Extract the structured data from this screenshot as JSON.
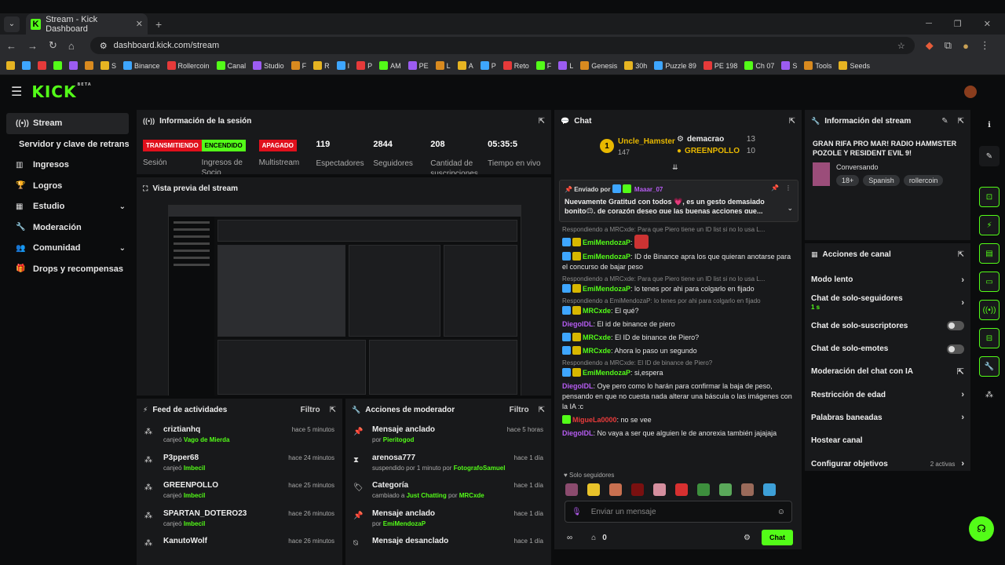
{
  "browser": {
    "tab_title": "Stream - Kick Dashboard",
    "url": "dashboard.kick.com/stream",
    "bookmarks": [
      "S",
      "Binance",
      "Rollercoin",
      "Canal",
      "Studio",
      "F",
      "R",
      "I",
      "P",
      "AM",
      "PE",
      "L",
      "A",
      "P",
      "Reto",
      "F",
      "L",
      "Genesis",
      "30h",
      "Puzzle 89",
      "PE 198",
      "Ch 07",
      "S",
      "Tools",
      "Seeds"
    ]
  },
  "site": {
    "logo": "KICK",
    "beta": "BETA"
  },
  "sidebar": {
    "items": [
      {
        "label": "Stream",
        "icon": "broadcast-icon",
        "active": true
      },
      {
        "label": "Servidor y clave de retransmisión",
        "sub": true
      },
      {
        "label": "Ingresos",
        "icon": "chart-icon"
      },
      {
        "label": "Logros",
        "icon": "trophy-icon"
      },
      {
        "label": "Estudio",
        "icon": "studio-icon",
        "chev": true
      },
      {
        "label": "Moderación",
        "icon": "wrench-icon"
      },
      {
        "label": "Comunidad",
        "icon": "people-icon",
        "chev": true
      },
      {
        "label": "Drops y recompensas",
        "icon": "gift-icon"
      }
    ]
  },
  "session": {
    "title": "Información de la sesión",
    "stats": [
      {
        "badge": "TRANSMITIENDO",
        "color": "red",
        "label": "Sesión"
      },
      {
        "badge": "ENCENDIDO",
        "color": "green",
        "label": "Ingresos de Socio"
      },
      {
        "badge": "APAGADO",
        "color": "red",
        "label": "Multistream"
      },
      {
        "value": "119",
        "label": "Espectadores"
      },
      {
        "value": "2844",
        "label": "Seguidores"
      },
      {
        "value": "208",
        "label": "Cantidad de suscripciones"
      },
      {
        "value": "05:35:5",
        "label": "Tiempo en vivo"
      }
    ]
  },
  "preview": {
    "title": "Vista previa del stream"
  },
  "feed": {
    "title": "Feed de actividades",
    "filter": "Filtro",
    "items": [
      {
        "name": "criztianhq",
        "action": "canjeó",
        "reward": "Vago de Mierda",
        "time": "hace 5 minutos"
      },
      {
        "name": "P3pper68",
        "action": "canjeó",
        "reward": "Imbecil",
        "time": "hace 24 minutos"
      },
      {
        "name": "GREENPOLLO",
        "action": "canjeó",
        "reward": "Imbecil",
        "time": "hace 25 minutos"
      },
      {
        "name": "SPARTAN_DOTERO23",
        "action": "canjeó",
        "reward": "Imbecil",
        "time": "hace 26 minutos"
      },
      {
        "name": "KanutoWolf",
        "action": "",
        "reward": "",
        "time": "hace 26 minutos"
      }
    ]
  },
  "modactions": {
    "title": "Acciones de moderador",
    "filter": "Filtro",
    "items": [
      {
        "name": "Mensaje anclado",
        "sub": "por",
        "who": "Pieritogod",
        "time": "hace 5 horas",
        "icon": "pin-icon"
      },
      {
        "name": "arenosa777",
        "sub": "suspendido por 1 minuto por",
        "who": "FotografoSamuel",
        "time": "hace 1 día",
        "icon": "hourglass-icon"
      },
      {
        "name": "Categoría",
        "sub": "cambiado a",
        "who": "Just Chatting",
        "sub2": "por",
        "who2": "MRCxde",
        "time": "hace 1 día",
        "icon": "tag-icon"
      },
      {
        "name": "Mensaje anclado",
        "sub": "por",
        "who": "EmiMendozaP",
        "time": "hace 1 día",
        "icon": "pin-icon"
      },
      {
        "name": "Mensaje desanclado",
        "sub": "",
        "who": "",
        "time": "hace 1 día",
        "icon": "unpin-icon"
      }
    ]
  },
  "chat": {
    "title": "Chat",
    "top1_name": "Uncle_Hamster",
    "top1_count": "147",
    "top1_rank": "1",
    "top2": [
      {
        "name": "demacrao",
        "count": "13"
      },
      {
        "name": "GREENPOLLO",
        "count": "10"
      }
    ],
    "pinned_by_label": "Enviado por",
    "pinned_by": "Maaar_07",
    "pinned_text": "Nuevamente Gratitud con todos 💗, es un gesto demasiado bonito😉, de corazón deseo que las buenas acciones que...",
    "messages": [
      {
        "reply": "Respondiendo a MRCxde: Para que Piero tiene un ID list si no lo usa L...",
        "user": "EmiMendozaP",
        "ucls": "ugreen",
        "text": "",
        "badges": [
          "blue",
          "gold"
        ]
      },
      {
        "reply": "",
        "user": "EmiMendozaP",
        "ucls": "ugreen",
        "text": "ID de Binance apra los que quieran anotarse para el concurso de bajar peso",
        "badges": [
          "blue",
          "gold"
        ]
      },
      {
        "reply": "Respondiendo a MRCxde: Para que Piero tiene un ID list si no lo usa L...",
        "user": "EmiMendozaP",
        "ucls": "ugreen",
        "text": "lo tenes por ahi para colgarlo en fijado",
        "badges": [
          "blue",
          "gold"
        ]
      },
      {
        "reply": "Respondiendo a EmiMendozaP: lo tenes por ahi para colgarlo en fijado",
        "user": "MRCxde",
        "ucls": "ugreen",
        "text": "El qué?",
        "badges": [
          "blue",
          "gold"
        ]
      },
      {
        "reply": "",
        "user": "DiegoIDL",
        "ucls": "upurple",
        "text": "El id de binance de piero",
        "badges": []
      },
      {
        "reply": "",
        "user": "MRCxde",
        "ucls": "ugreen",
        "text": "El ID de binance de Piero?",
        "badges": [
          "blue",
          "gold"
        ]
      },
      {
        "reply": "",
        "user": "MRCxde",
        "ucls": "ugreen",
        "text": "Ahora lo paso un segundo",
        "badges": [
          "blue",
          "gold"
        ]
      },
      {
        "reply": "Respondiendo a MRCxde: El ID de binance de Piero?",
        "user": "EmiMendozaP",
        "ucls": "ugreen",
        "text": "si,espera",
        "badges": [
          "blue",
          "gold"
        ]
      },
      {
        "reply": "",
        "user": "DiegoIDL",
        "ucls": "upurple",
        "text": "Oye pero como lo harán para confirmar la baja de peso, pensando en que no cuesta nada alterar una báscula o las imágenes con la IA :c",
        "badges": []
      },
      {
        "reply": "",
        "user": "MigueLa0000",
        "ucls": "ured",
        "text": "no se vee",
        "badges": [
          "gr"
        ]
      },
      {
        "reply": "",
        "user": "DiegoIDL",
        "ucls": "upurple",
        "text": "No vaya a ser que alguien le de anorexia también jajajaja",
        "badges": []
      }
    ],
    "followers_only": "Solo seguidores",
    "input_placeholder": "Enviar un mensaje",
    "points": "0",
    "send": "Chat"
  },
  "streaminfo": {
    "title": "Información del stream",
    "stream_title": "GRAN RIFA PRO MAR! RADIO HAMMSTER POZOLE Y RESIDENT EVIL 9!",
    "category": "Conversando",
    "tags": [
      "18+",
      "Spanish",
      "rollercoin"
    ]
  },
  "channel": {
    "title": "Acciones de canal",
    "items": [
      {
        "label": "Modo lento",
        "type": "arrow"
      },
      {
        "label": "Chat de solo-seguidores",
        "sub": "1 s",
        "type": "arrow"
      },
      {
        "label": "Chat de solo-suscriptores",
        "type": "toggle"
      },
      {
        "label": "Chat de solo-emotes",
        "type": "toggle"
      },
      {
        "label": "Moderación del chat con IA",
        "type": "ext"
      },
      {
        "label": "Restricción de edad",
        "type": "arrow"
      },
      {
        "label": "Palabras baneadas",
        "type": "arrow"
      },
      {
        "label": "Hostear canal",
        "type": "none"
      },
      {
        "label": "Configurar objetivos",
        "extra": "2 activas",
        "type": "arrow"
      }
    ]
  }
}
